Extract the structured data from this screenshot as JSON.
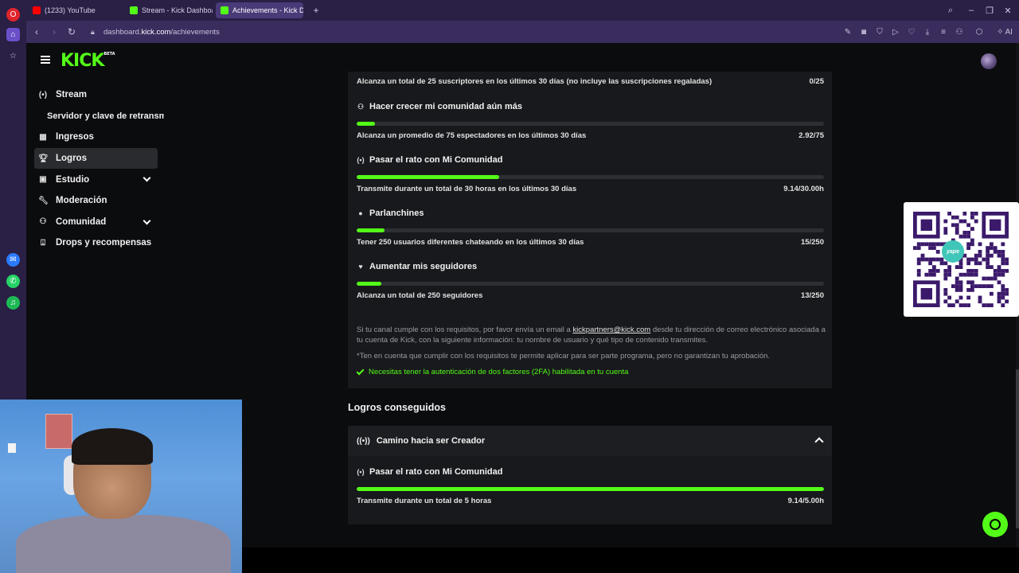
{
  "browser": {
    "tabs": [
      {
        "label": "(1233) YouTube",
        "color": "#ff0000"
      },
      {
        "label": "Stream - Kick Dashboard",
        "color": "#53fc18"
      },
      {
        "label": "Achievements - Kick Dash",
        "color": "#53fc18"
      }
    ],
    "url_host": "dashboard.kick.com",
    "url_path": "/achievements",
    "url_prefix": "dashboard.",
    "url_domain": "kick.com",
    "ai_label": "AI"
  },
  "app": {
    "logo": "KICK",
    "logo_badge": "BETA",
    "accent": "#53fc18"
  },
  "sidebar": {
    "items": [
      {
        "label": "Stream",
        "icon": "broadcast-icon"
      },
      {
        "label": "Servidor y clave de retransm"
      },
      {
        "label": "Ingresos",
        "icon": "chart-icon"
      },
      {
        "label": "Logros",
        "icon": "trophy-icon"
      },
      {
        "label": "Estudio",
        "icon": "studio-icon"
      },
      {
        "label": "Moderación",
        "icon": "wrench-icon"
      },
      {
        "label": "Comunidad",
        "icon": "community-icon"
      },
      {
        "label": "Drops y recompensas",
        "icon": "drops-icon"
      }
    ]
  },
  "achievements": {
    "top_row": {
      "desc": "Alcanza un total de 25 suscriptores en los últimos 30 días (no incluye las suscripciones regaladas)",
      "value": "0/25"
    },
    "items": [
      {
        "title": "Hacer crecer mi comunidad aún más",
        "icon": "community-grow-icon",
        "progress": 0.039,
        "desc": "Alcanza un promedio de 75 espectadores en los últimos 30 días",
        "value": "2.92/75"
      },
      {
        "title": "Pasar el rato con Mi Comunidad",
        "icon": "broadcast-icon",
        "progress": 0.305,
        "desc": "Transmite durante un total de 30 horas en los últimos 30 días",
        "value": "9.14/30.00h"
      },
      {
        "title": "Parlanchines",
        "icon": "chat-icon",
        "progress": 0.06,
        "desc": "Tener 250 usuarios diferentes chateando en los últimos 30 días",
        "value": "15/250"
      },
      {
        "title": "Aumentar mis seguidores",
        "icon": "heart-icon",
        "progress": 0.052,
        "desc": "Alcanza un total de 250 seguidores",
        "value": "13/250"
      }
    ],
    "note_before": "Si tu canal cumple con los requisitos, por favor envía un email a ",
    "note_email": "kickpartners@kick.com",
    "note_after": " desde tu dirección de correo electrónico asociada a tu cuenta de Kick, con la siguiente información: tu nombre de usuario y qué tipo de contenido transmites.",
    "note2": "*Ten en cuenta que cumplir con los requisitos te permite aplicar para ser parte programa, pero no garantizan tu aprobación.",
    "requirement": "Necesitas tener la autenticación de dos factores (2FA) habilitada en tu cuenta"
  },
  "completed": {
    "section_title": "Logros conseguidos",
    "group_title": "Camino hacia ser Creador",
    "item": {
      "title": "Pasar el rato con Mi Comunidad",
      "progress": 1.0,
      "desc": "Transmite durante un total de 5 horas",
      "value": "9.14/5.00h"
    }
  },
  "overlay": {
    "qr_label": "yape"
  }
}
